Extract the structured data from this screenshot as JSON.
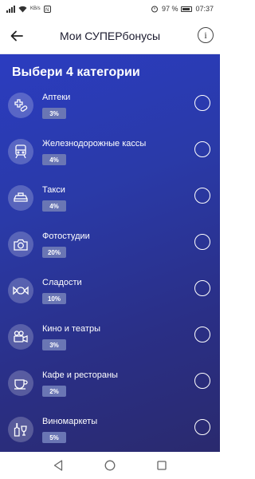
{
  "status_bar": {
    "battery": "97 %",
    "time": "07:37",
    "speed": "KB/s"
  },
  "header": {
    "title": "Мои СУПЕРбонусы",
    "info_glyph": "i"
  },
  "main": {
    "title": "Выбери 4 категории",
    "categories": [
      {
        "label": "Аптеки",
        "percent": "3%",
        "icon": "pharmacy-icon"
      },
      {
        "label": "Железнодорожные кассы",
        "percent": "4%",
        "icon": "train-icon"
      },
      {
        "label": "Такси",
        "percent": "4%",
        "icon": "taxi-icon"
      },
      {
        "label": "Фотостудии",
        "percent": "20%",
        "icon": "camera-icon"
      },
      {
        "label": "Сладости",
        "percent": "10%",
        "icon": "candy-icon"
      },
      {
        "label": "Кино и театры",
        "percent": "3%",
        "icon": "movie-camera-icon"
      },
      {
        "label": "Кафе и рестораны",
        "percent": "2%",
        "icon": "coffee-cup-icon"
      },
      {
        "label": "Виномаркеты",
        "percent": "5%",
        "icon": "wine-glass-icon"
      }
    ]
  },
  "colors": {
    "gradient_top": "#2b3cc0",
    "gradient_bottom": "#2a2a6e",
    "badge": "#6a76b4"
  }
}
